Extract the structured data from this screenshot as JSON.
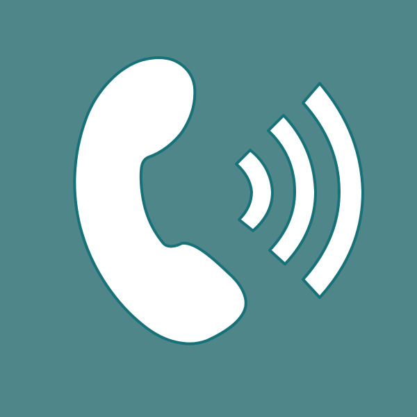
{
  "colors": {
    "background": "#4f8689",
    "icon_fill": "#ffffff",
    "icon_outline": "#167178"
  },
  "icon": {
    "name": "phone-ringing-icon",
    "signal_waves": 3
  }
}
